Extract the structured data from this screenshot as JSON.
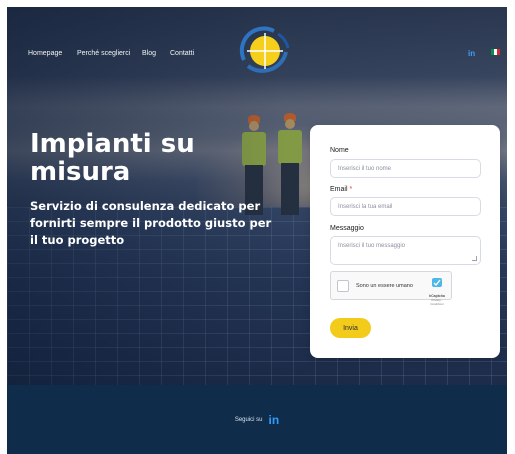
{
  "nav": {
    "items": [
      {
        "label": "Homepage"
      },
      {
        "label": "Perché sceglierci"
      },
      {
        "label": "Blog"
      },
      {
        "label": "Contatti"
      }
    ],
    "linkedin_icon": "linkedin-icon",
    "linkedin_glyph": "in",
    "language_flag": "italian-flag-icon",
    "flag_colors": [
      "#009246",
      "#ffffff",
      "#ce2b37"
    ]
  },
  "logo": {
    "icon": "solar-logo-icon",
    "colors": {
      "sun": "#f5cf1c",
      "ring": "#2f7fd6"
    }
  },
  "hero": {
    "title": "Impianti su misura",
    "subtitle": "Servizio di consulenza dedicato per fornirti sempre il prodotto giusto per il tuo progetto"
  },
  "form": {
    "name_label": "Nome",
    "name_placeholder": "Inserisci il tuo nome",
    "email_label": "Email",
    "email_required_mark": "*",
    "email_placeholder": "Inserisci la tua email",
    "message_label": "Messaggio",
    "message_placeholder": "Inserisci il tuo messaggio",
    "captcha": {
      "label": "Sono un essere umano",
      "brand": "hCaptcha",
      "links": "Privacy - Condizioni"
    },
    "submit_label": "Invia",
    "accent_color": "#f3cb1b"
  },
  "footer": {
    "follow_text": "Seguici su",
    "linkedin_glyph": "in",
    "background": "#0f2d4a"
  }
}
